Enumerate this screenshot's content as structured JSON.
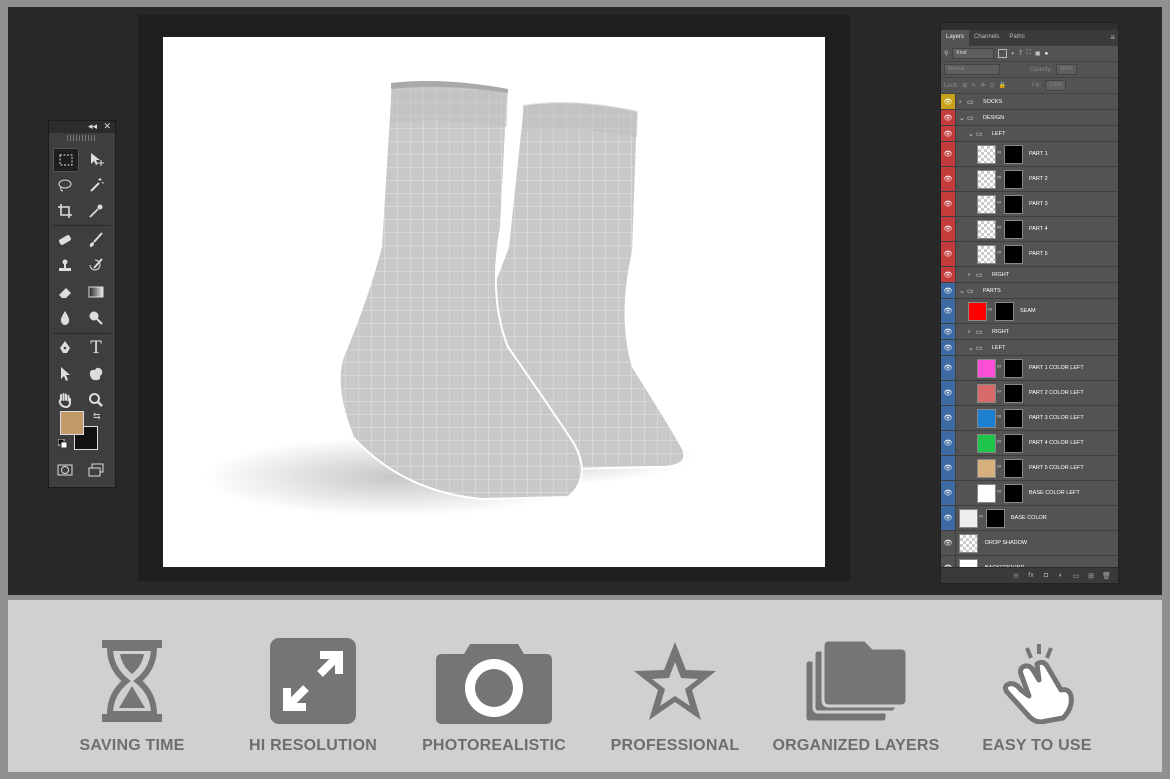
{
  "toolbox": {
    "collapse_glyph": "◂◂",
    "close_glyph": "✕",
    "tools": [
      "rectangular-marquee-icon",
      "move-icon",
      "lasso-icon",
      "magic-wand-icon",
      "crop-icon",
      "eyedropper-icon",
      "healing-brush-icon",
      "brush-icon",
      "clone-stamp-icon",
      "history-brush-icon",
      "eraser-icon",
      "gradient-icon",
      "blur-icon",
      "dodge-icon",
      "pen-icon",
      "type-icon",
      "path-selection-icon",
      "custom-shape-icon",
      "hand-icon",
      "zoom-icon",
      "quick-mask-icon",
      "screen-mode-icon"
    ],
    "type_glyph": "T",
    "foreground_color": "#c29a69",
    "background_color": "#111111"
  },
  "layers_panel": {
    "tabs": [
      "Layers",
      "Channels",
      "Paths"
    ],
    "filter_kind": "Kind",
    "blend_mode": "Normal",
    "opacity_label": "Opacity:",
    "opacity_value": "100%",
    "lock_label": "Lock:",
    "fill_label": "Fill:",
    "fill_value": "100%",
    "layers": [
      {
        "name": "SOCKS",
        "type": "group",
        "indent": 0,
        "color": "#c6a21a"
      },
      {
        "name": "DESIGN",
        "type": "group-open",
        "indent": 0,
        "color": "#c43b3b"
      },
      {
        "name": "LEFT",
        "type": "group-open",
        "indent": 1,
        "color": "#c43b3b"
      },
      {
        "name": "PART 1",
        "type": "smart",
        "indent": 2,
        "color": "#c43b3b"
      },
      {
        "name": "PART 2",
        "type": "smart",
        "indent": 2,
        "color": "#c43b3b"
      },
      {
        "name": "PART 3",
        "type": "smart",
        "indent": 2,
        "color": "#c43b3b"
      },
      {
        "name": "PART 4",
        "type": "smart",
        "indent": 2,
        "color": "#c43b3b"
      },
      {
        "name": "PART 5",
        "type": "smart",
        "indent": 2,
        "color": "#c43b3b"
      },
      {
        "name": "RIGHT",
        "type": "group",
        "indent": 1,
        "color": "#c43b3b"
      },
      {
        "name": "PARTS",
        "type": "group-open",
        "indent": 0,
        "color": "#3d6aa3"
      },
      {
        "name": "SEAM",
        "type": "fill",
        "indent": 1,
        "color": "#3d6aa3",
        "swatch": "#ff0000"
      },
      {
        "name": "RIGHT",
        "type": "group",
        "indent": 1,
        "color": "#3d6aa3"
      },
      {
        "name": "LEFT",
        "type": "group-open",
        "indent": 1,
        "color": "#3d6aa3"
      },
      {
        "name": "PART 1 COLOR LEFT",
        "type": "fill",
        "indent": 2,
        "color": "#3d6aa3",
        "swatch": "#ff4fd8"
      },
      {
        "name": "PART 2 COLOR LEFT",
        "type": "fill",
        "indent": 2,
        "color": "#3d6aa3",
        "swatch": "#d96a6a"
      },
      {
        "name": "PART 3 COLOR LEFT",
        "type": "fill",
        "indent": 2,
        "color": "#3d6aa3",
        "swatch": "#1d7fd0"
      },
      {
        "name": "PART 4 COLOR LEFT",
        "type": "fill",
        "indent": 2,
        "color": "#3d6aa3",
        "swatch": "#1fc44a"
      },
      {
        "name": "PART 5 COLOR LEFT",
        "type": "fill",
        "indent": 2,
        "color": "#3d6aa3",
        "swatch": "#d6b07c"
      },
      {
        "name": "BASE COLOR LEFT",
        "type": "fill",
        "indent": 2,
        "color": "#3d6aa3",
        "swatch": "#ffffff"
      },
      {
        "name": "BASE COLOR",
        "type": "fill",
        "indent": 0,
        "color": "#3d6aa3",
        "swatch": "#eeeeee"
      },
      {
        "name": "DROP SHADOW",
        "type": "pixel",
        "indent": 0,
        "color": ""
      },
      {
        "name": "BACKGROUND",
        "type": "solid",
        "indent": 0,
        "color": ""
      }
    ],
    "footer_icons": [
      "link-layers-icon",
      "fx-icon",
      "add-mask-icon",
      "adjustment-layer-icon",
      "new-group-icon",
      "new-layer-icon",
      "delete-layer-icon"
    ],
    "footer_glyphs": [
      "⊝",
      "fx",
      "◘",
      "◐",
      "▭",
      "⊞",
      "🗑"
    ]
  },
  "features": [
    {
      "label": "SAVING TIME",
      "icon": "hourglass-icon"
    },
    {
      "label": "HI RESOLUTION",
      "icon": "expand-arrows-icon"
    },
    {
      "label": "PHOTOREALISTIC",
      "icon": "camera-icon"
    },
    {
      "label": "PROFESSIONAL",
      "icon": "star-icon"
    },
    {
      "label": "ORGANIZED LAYERS",
      "icon": "stacked-folders-icon"
    },
    {
      "label": "EASY TO USE",
      "icon": "tap-hand-icon"
    }
  ]
}
